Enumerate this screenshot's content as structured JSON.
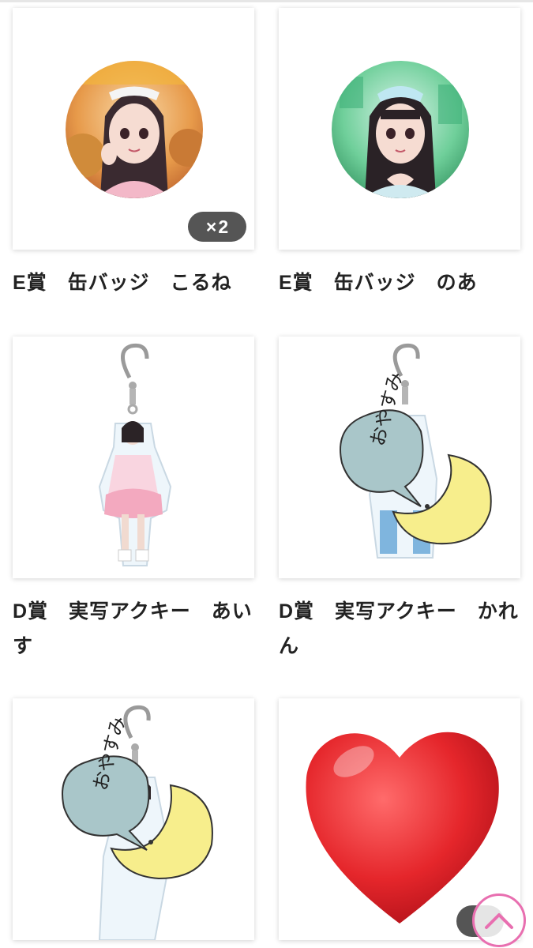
{
  "items": [
    {
      "title": "E賞　缶バッジ　こるね",
      "quantity_badge": {
        "symbol": "×",
        "count": "2"
      },
      "art": "photo-badge-pink"
    },
    {
      "title": "E賞　缶バッジ　のあ",
      "art": "photo-badge-green"
    },
    {
      "title": "D賞　実写アクキー　あいす",
      "art": "acrylic-keychain-white-dress"
    },
    {
      "title": "D賞　実写アクキー　かれん",
      "art": "acrylic-keychain-oyasumi",
      "speech_bubble_text": "おやすみ"
    },
    {
      "title": "",
      "art": "acrylic-keychain-oyasumi",
      "speech_bubble_text": "おやすみ"
    },
    {
      "title": "",
      "art": "red-heart-emoji"
    }
  ],
  "scroll_top_button": {
    "icon": "chevron-up-icon",
    "border_color": "#e86fb0"
  },
  "colors": {
    "badge_bg": "#555555",
    "heart": "#e5262b",
    "moon": "#f7ee8c",
    "bubble": "#a9c6c9"
  }
}
